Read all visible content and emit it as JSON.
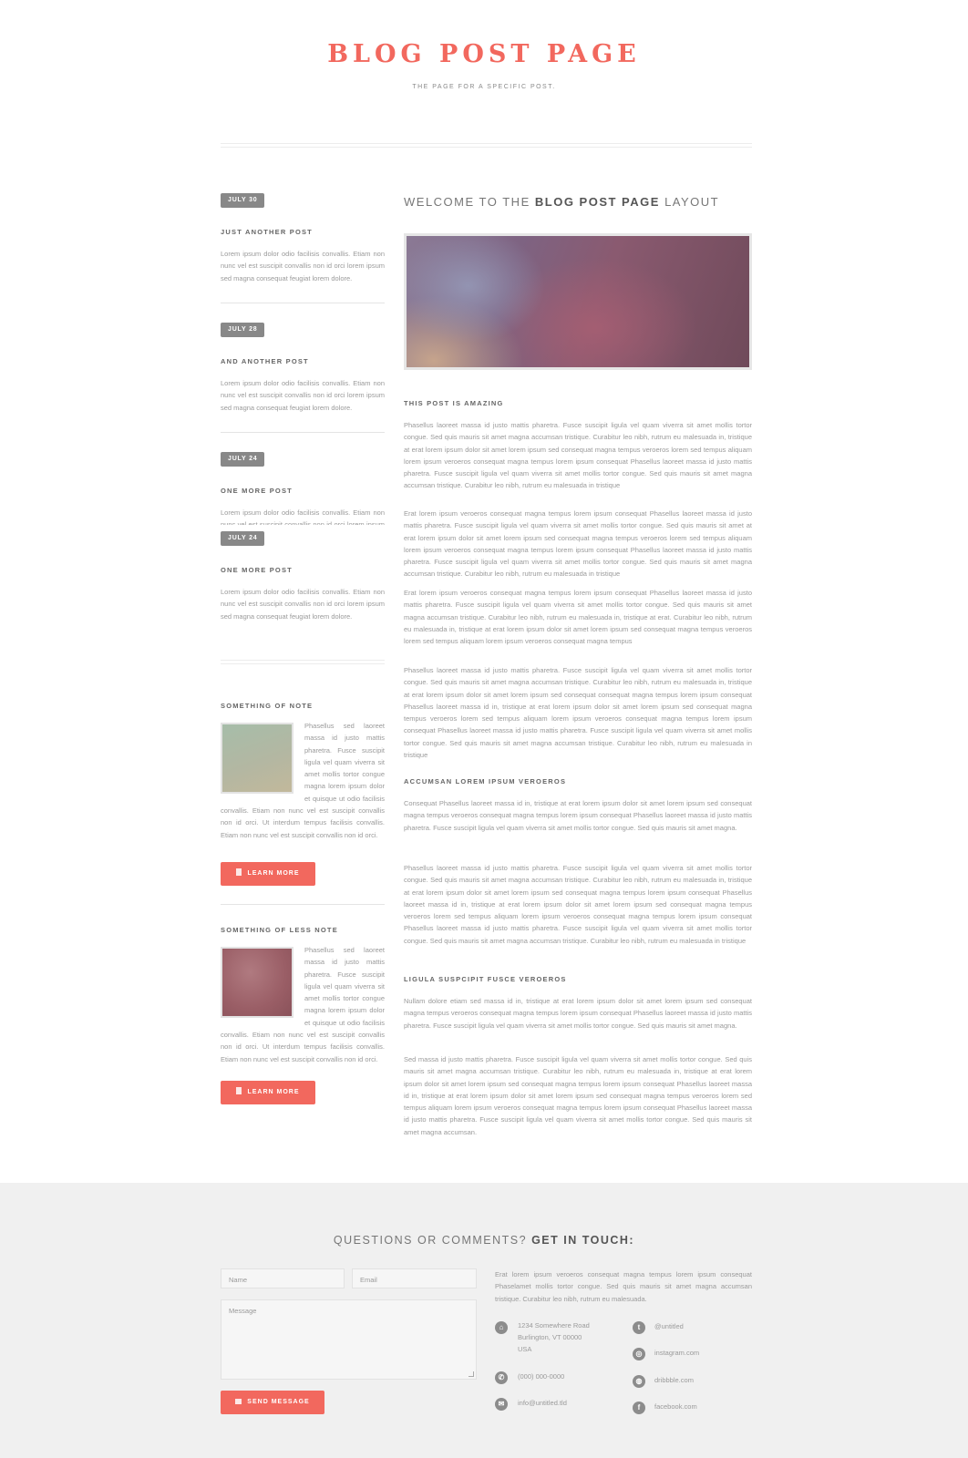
{
  "header": {
    "title": "BLOG POST PAGE",
    "subtitle": "THE PAGE FOR A SPECIFIC POST."
  },
  "sidebar": {
    "posts": [
      {
        "date": "JULY 30",
        "title": "JUST ANOTHER POST",
        "excerpt": "Lorem ipsum dolor odio facilisis convallis. Etiam non nunc vel est suscipit convallis non id orci lorem ipsum sed magna consequat feugiat lorem dolore."
      },
      {
        "date": "JULY 28",
        "title": "AND ANOTHER POST",
        "excerpt": "Lorem ipsum dolor odio facilisis convallis. Etiam non nunc vel est suscipit convallis non id orci lorem ipsum sed magna consequat feugiat lorem dolore."
      },
      {
        "date": "JULY 24",
        "title": "ONE MORE POST",
        "excerpt": "Lorem ipsum dolor odio facilisis convallis. Etiam non nunc vel est suscipit convallis non id orci lorem ipsum sed magna consequat feugiat lorem dolore."
      },
      {
        "date": "JULY 24",
        "title": "ONE MORE POST",
        "excerpt": "Lorem ipsum dolor odio facilisis convallis. Etiam non nunc vel est suscipit convallis non id orci lorem ipsum sed magna consequat feugiat lorem dolore."
      }
    ],
    "notes": [
      {
        "heading": "SOMETHING OF NOTE",
        "text": "Phasellus sed laoreet massa id justo mattis pharetra. Fusce suscipit ligula vel quam viverra sit amet mollis tortor congue magna lorem ipsum dolor et quisque ut odio facilisis convallis. Etiam non nunc vel est suscipit convallis non id orci. Ut interdum tempus facilisis convallis. Etiam non nunc vel est suscipit convallis non id orci.",
        "button": "LEARN MORE",
        "thumb_color": "#a8bba8"
      },
      {
        "heading": "SOMETHING OF LESS NOTE",
        "text": "Phasellus sed laoreet massa id justo mattis pharetra. Fusce suscipit ligula vel quam viverra sit amet mollis tortor congue magna lorem ipsum dolor et quisque ut odio facilisis convallis. Etiam non nunc vel est suscipit convallis non id orci. Ut interdum tempus facilisis convallis. Etiam non nunc vel est suscipit convallis non id orci.",
        "button": "LEARN MORE",
        "thumb_color": "#9a5e66"
      }
    ]
  },
  "main": {
    "heading_pre": "WELCOME TO THE",
    "heading_bold": "BLOG POST PAGE",
    "heading_post": "LAYOUT",
    "section1": "THIS POST IS AMAZING",
    "p1": "Phasellus laoreet massa id justo mattis pharetra. Fusce suscipit ligula vel quam viverra sit amet mollis tortor congue. Sed quis mauris sit amet magna accumsan tristique. Curabitur leo nibh, rutrum eu malesuada in, tristique at erat lorem ipsum dolor sit amet lorem ipsum sed consequat magna tempus veroeros lorem sed tempus aliquam lorem ipsum veroeros consequat magna tempus lorem ipsum consequat Phasellus laoreet massa id justo mattis pharetra. Fusce suscipit ligula vel quam viverra sit amet mollis tortor congue. Sed quis mauris sit amet magna accumsan tristique. Curabitur leo nibh, rutrum eu malesuada in tristique",
    "p2": "Erat lorem ipsum veroeros consequat magna tempus lorem ipsum consequat Phasellus laoreet massa id justo mattis pharetra. Fusce suscipit ligula vel quam viverra sit amet mollis tortor congue. Sed quis mauris sit amet at erat lorem ipsum dolor sit amet lorem ipsum sed consequat magna tempus veroeros lorem sed tempus aliquam lorem ipsum veroeros consequat magna tempus lorem ipsum consequat Phasellus laoreet massa id justo mattis pharetra. Fusce suscipit ligula vel quam viverra sit amet mollis tortor congue. Sed quis mauris sit amet magna accumsan tristique. Curabitur leo nibh, rutrum eu malesuada in tristique",
    "p3": "Erat lorem ipsum veroeros consequat magna tempus lorem ipsum consequat Phasellus laoreet massa id justo mattis pharetra. Fusce suscipit ligula vel quam viverra sit amet mollis tortor congue. Sed quis mauris sit amet magna accumsan tristique. Curabitur leo nibh, rutrum eu malesuada in, tristique at erat. Curabitur leo nibh, rutrum eu malesuada in, tristique at erat lorem ipsum dolor sit amet lorem ipsum sed consequat magna tempus veroeros lorem sed tempus aliquam lorem ipsum veroeros consequat magna tempus",
    "p4": "Phasellus laoreet massa id justo mattis pharetra. Fusce suscipit ligula vel quam viverra sit amet mollis tortor congue. Sed quis mauris sit amet magna accumsan tristique. Curabitur leo nibh, rutrum eu malesuada in, tristique at erat lorem ipsum dolor sit amet lorem ipsum sed consequat consequat magna tempus lorem ipsum consequat Phasellus laoreet massa id in, tristique at erat lorem ipsum dolor sit amet lorem ipsum sed consequat magna tempus veroeros lorem sed tempus aliquam lorem ipsum veroeros consequat magna tempus lorem ipsum consequat Phasellus laoreet massa id justo mattis pharetra. Fusce suscipit ligula vel quam viverra sit amet mollis tortor congue. Sed quis mauris sit amet magna accumsan tristique. Curabitur leo nibh, rutrum eu malesuada in tristique",
    "section2": "ACCUMSAN LOREM IPSUM VEROEROS",
    "p5": "Consequat Phasellus laoreet massa id in, tristique at erat lorem ipsum dolor sit amet lorem ipsum sed consequat magna tempus veroeros consequat magna tempus lorem ipsum consequat Phasellus laoreet massa id justo mattis pharetra. Fusce suscipit ligula vel quam viverra sit amet mollis tortor congue. Sed quis mauris sit amet magna.",
    "p6": "Phasellus laoreet massa id justo mattis pharetra. Fusce suscipit ligula vel quam viverra sit amet mollis tortor congue. Sed quis mauris sit amet magna accumsan tristique. Curabitur leo nibh, rutrum eu malesuada in, tristique at erat lorem ipsum dolor sit amet lorem ipsum sed consequat magna tempus lorem ipsum consequat Phasellus laoreet massa id in, tristique at erat lorem ipsum dolor sit amet lorem ipsum sed consequat magna tempus veroeros lorem sed tempus aliquam lorem ipsum veroeros consequat magna tempus lorem ipsum consequat Phasellus laoreet massa id justo mattis pharetra. Fusce suscipit ligula vel quam viverra sit amet mollis tortor congue. Sed quis mauris sit amet magna accumsan tristique. Curabitur leo nibh, rutrum eu malesuada in tristique",
    "section3": "LIGULA SUSPCIPIT FUSCE VEROEROS",
    "p7": "Nullam dolore etiam sed massa id in, tristique at erat lorem ipsum dolor sit amet lorem ipsum sed consequat magna tempus veroeros consequat magna tempus lorem ipsum consequat Phasellus laoreet massa id justo mattis pharetra. Fusce suscipit ligula vel quam viverra sit amet mollis tortor congue. Sed quis mauris sit amet magna.",
    "p8": "Sed massa id justo mattis pharetra. Fusce suscipit ligula vel quam viverra sit amet mollis tortor congue. Sed quis mauris sit amet magna accumsan tristique. Curabitur leo nibh, rutrum eu malesuada in, tristique at erat lorem ipsum dolor sit amet lorem ipsum sed consequat magna tempus lorem ipsum consequat Phasellus laoreet massa id in, tristique at erat lorem ipsum dolor sit amet lorem ipsum sed consequat magna tempus veroeros lorem sed tempus aliquam lorem ipsum veroeros consequat magna tempus lorem ipsum consequat Phasellus laoreet massa id justo mattis pharetra. Fusce suscipit ligula vel quam viverra sit amet mollis tortor congue. Sed quis mauris sit amet magna accumsan."
  },
  "footer": {
    "heading_pre": "QUESTIONS OR COMMENTS?",
    "heading_bold": "GET IN TOUCH:",
    "name_placeholder": "Name",
    "email_placeholder": "Email",
    "message_placeholder": "Message",
    "send_label": "SEND MESSAGE",
    "text": "Erat lorem ipsum veroeros consequat magna tempus lorem ipsum consequat Phaselamet mollis tortor congue. Sed quis mauris sit amet magna accumsan tristique. Curabitur leo nibh, rutrum eu malesuada.",
    "address_line1": "1234 Somewhere Road",
    "address_line2": "Burlington, VT 00000",
    "address_line3": "USA",
    "phone": "(000) 000-0000",
    "email": "info@untitled.tld",
    "twitter": "@untitled",
    "instagram": "instagram.com",
    "dribbble": "dribbble.com",
    "facebook": "facebook.com"
  },
  "colors": {
    "accent": "#f2685e",
    "badge": "#888888",
    "footer_bg": "#f0f0f0"
  }
}
